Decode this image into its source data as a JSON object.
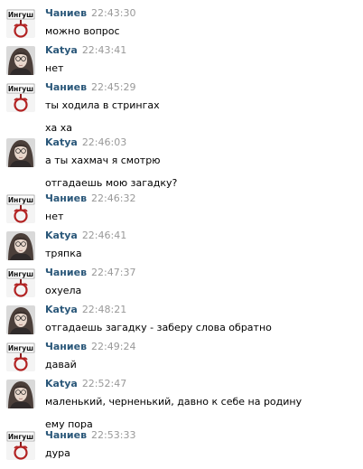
{
  "colors": {
    "name": "#2b587a",
    "time": "#999999",
    "text": "#000000"
  },
  "icons": {
    "chaniev_avatar": "ingush-badge-icon",
    "katya_avatar": "girl-photo-avatar"
  },
  "messages": [
    {
      "author": "Чаниев",
      "avatar": "chaniev",
      "time": "22:43:30",
      "lines": [
        "можно вопрос"
      ]
    },
    {
      "author": "Katya",
      "avatar": "katya",
      "time": "22:43:41",
      "lines": [
        "нет"
      ]
    },
    {
      "author": "Чаниев",
      "avatar": "chaniev",
      "time": "22:45:29",
      "lines": [
        "ты ходила в стрингах",
        "ха ха"
      ]
    },
    {
      "author": "Katya",
      "avatar": "katya",
      "time": "22:46:03",
      "lines": [
        "а ты хахмач я смотрю",
        "отгадаешь мою загадку?"
      ]
    },
    {
      "author": "Чаниев",
      "avatar": "chaniev",
      "time": "22:46:32",
      "lines": [
        "нет"
      ]
    },
    {
      "author": "Katya",
      "avatar": "katya",
      "time": "22:46:41",
      "lines": [
        "тряпка"
      ]
    },
    {
      "author": "Чаниев",
      "avatar": "chaniev",
      "time": "22:47:37",
      "lines": [
        "охуела"
      ]
    },
    {
      "author": "Katya",
      "avatar": "katya",
      "time": "22:48:21",
      "lines": [
        "отгадаешь загадку - заберу слова обратно"
      ]
    },
    {
      "author": "Чаниев",
      "avatar": "chaniev",
      "time": "22:49:24",
      "lines": [
        "давай"
      ]
    },
    {
      "author": "Katya",
      "avatar": "katya",
      "time": "22:52:47",
      "lines": [
        "маленький, черненький, давно к себе на родину",
        "ему пора"
      ]
    },
    {
      "author": "Чаниев",
      "avatar": "chaniev",
      "time": "22:53:33",
      "lines": [
        "дура"
      ]
    }
  ],
  "badge_text": "Ингуш"
}
